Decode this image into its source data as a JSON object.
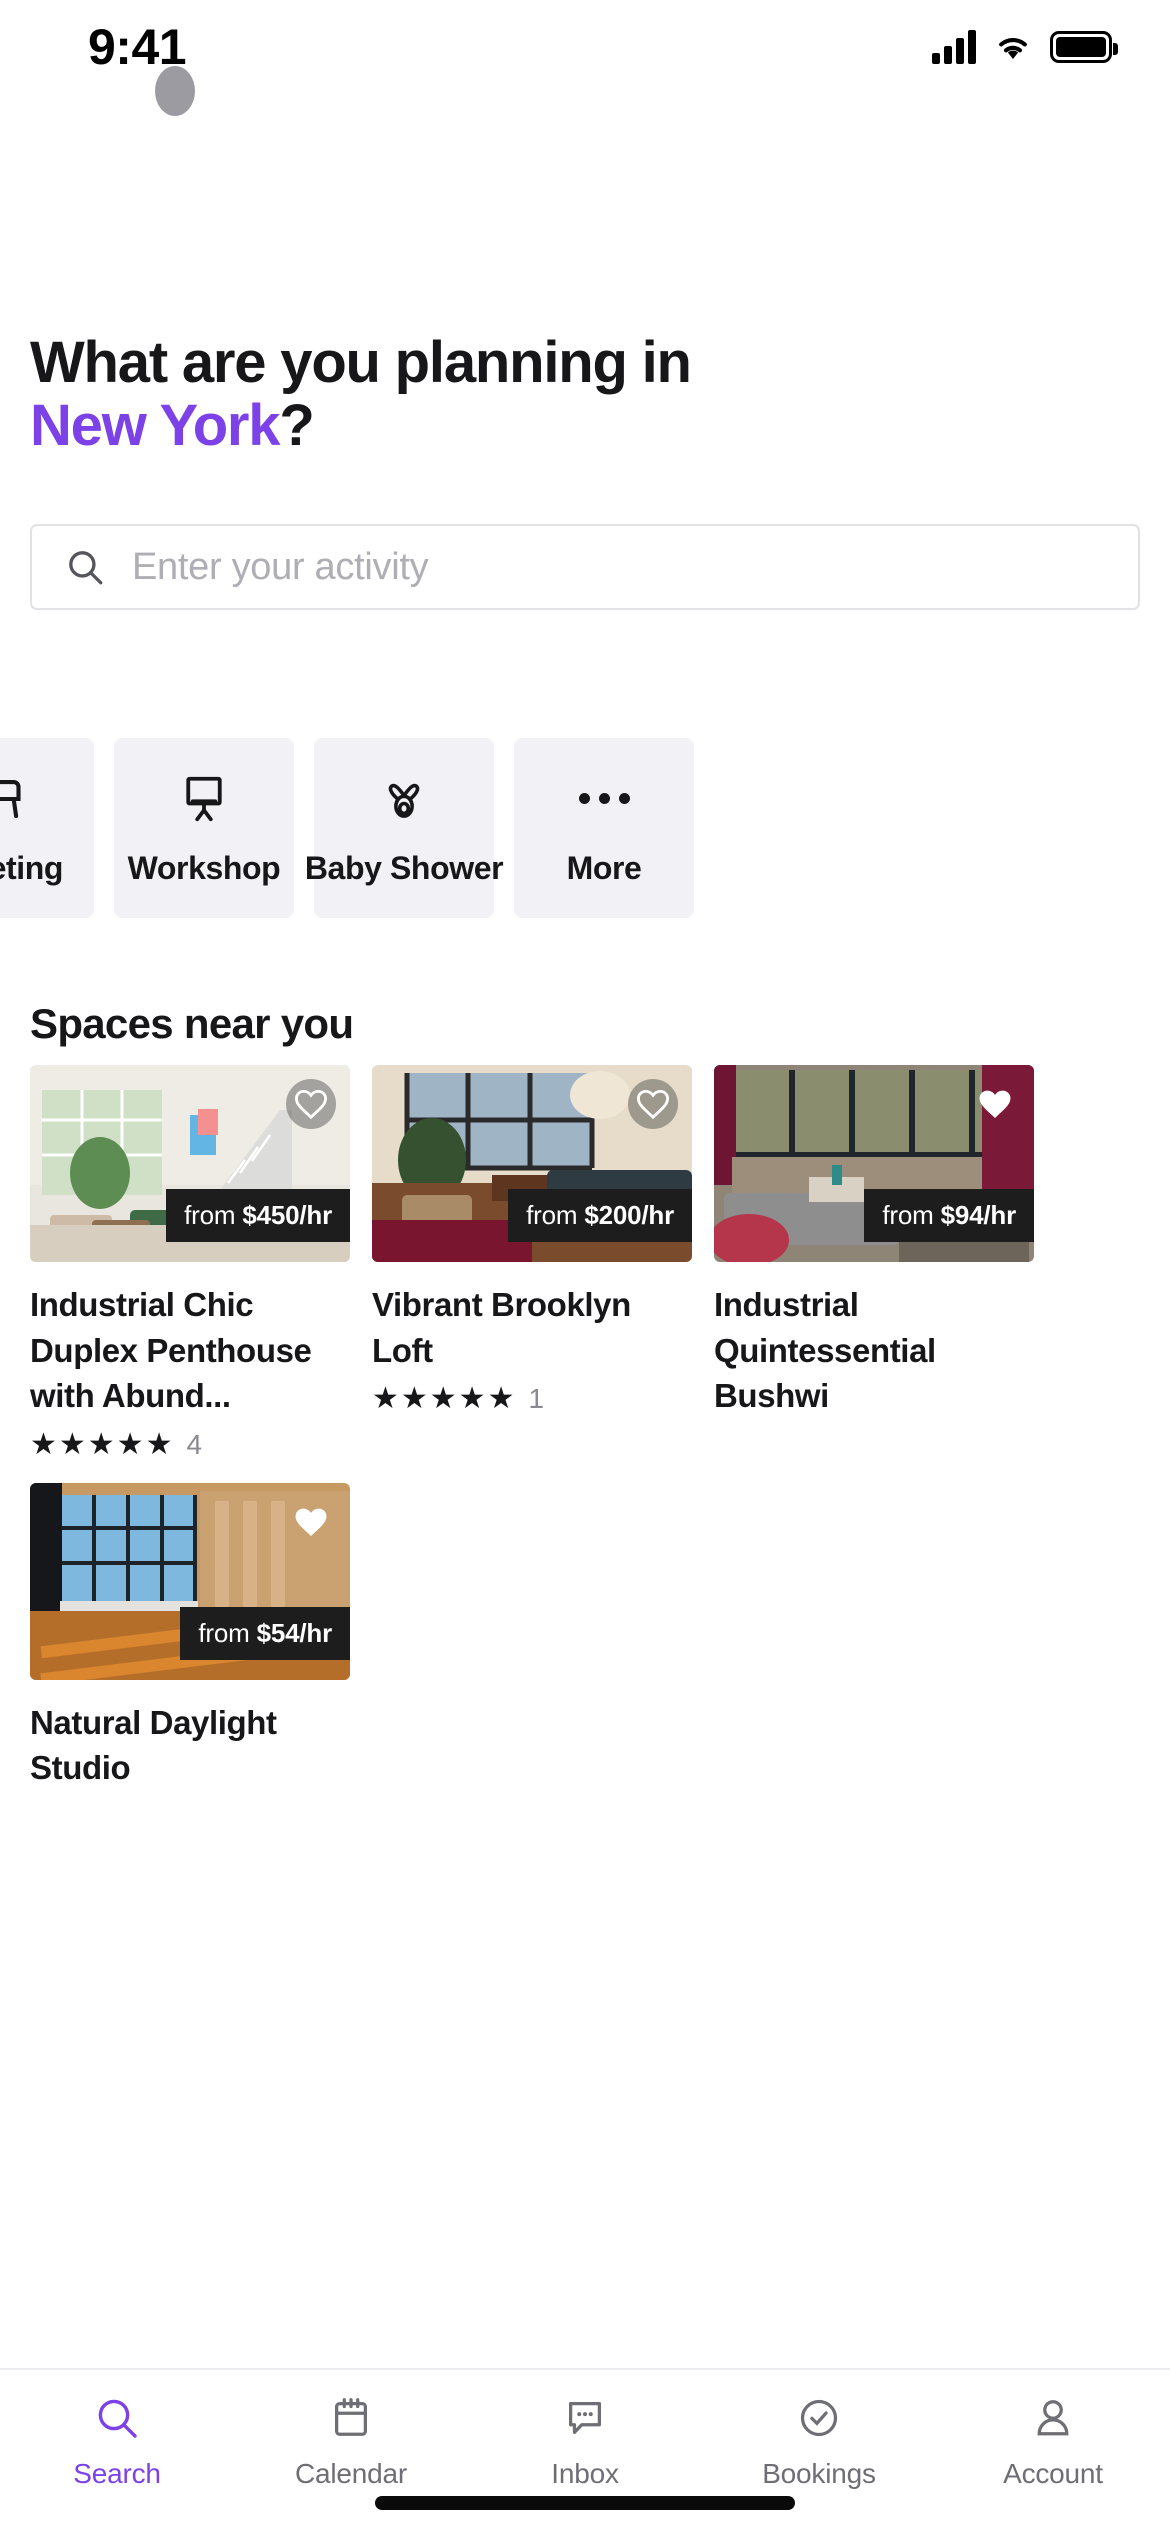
{
  "status_bar": {
    "time": "9:41",
    "signal_icon": "cellular-signal-icon",
    "wifi_icon": "wifi-icon",
    "battery_icon": "battery-icon"
  },
  "header": {
    "line1": "What are you planning in",
    "city": "New York",
    "line2_suffix": "?",
    "city_color": "#7c42e8"
  },
  "search": {
    "placeholder": "Enter your activity",
    "icon": "search-icon"
  },
  "categories": [
    {
      "label": "Meeting",
      "icon": "meeting-chair-icon",
      "partial": true
    },
    {
      "label": "Workshop",
      "icon": "flipchart-easel-icon",
      "partial": false
    },
    {
      "label": "Baby Shower",
      "icon": "pacifier-icon",
      "partial": false
    },
    {
      "label": "More",
      "icon": "ellipsis-icon",
      "partial": false
    }
  ],
  "section": {
    "title": "Spaces near you"
  },
  "spaces": [
    {
      "title": "Industrial Chic Duplex Penthouse with Abund...",
      "price_prefix": "from",
      "price": "$450/hr",
      "stars": "★★★★★",
      "rating_count": "4",
      "favorite_icon": "heart-outline-icon",
      "heart_shaded": true
    },
    {
      "title": "Vibrant Brooklyn Loft",
      "price_prefix": "from",
      "price": "$200/hr",
      "stars": "★★★★★",
      "rating_count": "1",
      "favorite_icon": "heart-outline-icon",
      "heart_shaded": true
    },
    {
      "title": "Industrial Quintessential Bushwi",
      "price_prefix": "from",
      "price": "$94/hr",
      "stars": "",
      "rating_count": "",
      "favorite_icon": "heart-filled-icon",
      "heart_shaded": false
    },
    {
      "title": "Natural Daylight Studio",
      "price_prefix": "from",
      "price": "$54/hr",
      "stars": "",
      "rating_count": "",
      "favorite_icon": "heart-filled-icon",
      "heart_shaded": false
    }
  ],
  "tabs": [
    {
      "label": "Search",
      "icon": "search-icon",
      "active": true
    },
    {
      "label": "Calendar",
      "icon": "calendar-icon",
      "active": false
    },
    {
      "label": "Inbox",
      "icon": "chat-bubble-icon",
      "active": false
    },
    {
      "label": "Bookings",
      "icon": "check-circle-icon",
      "active": false
    },
    {
      "label": "Account",
      "icon": "person-icon",
      "active": false
    }
  ],
  "theme": {
    "accent": "#7c42e8",
    "chip_bg": "#f2f2f6",
    "badge_bg": "#1d1d1d",
    "text": "#17171a",
    "muted": "#8a8a90"
  }
}
